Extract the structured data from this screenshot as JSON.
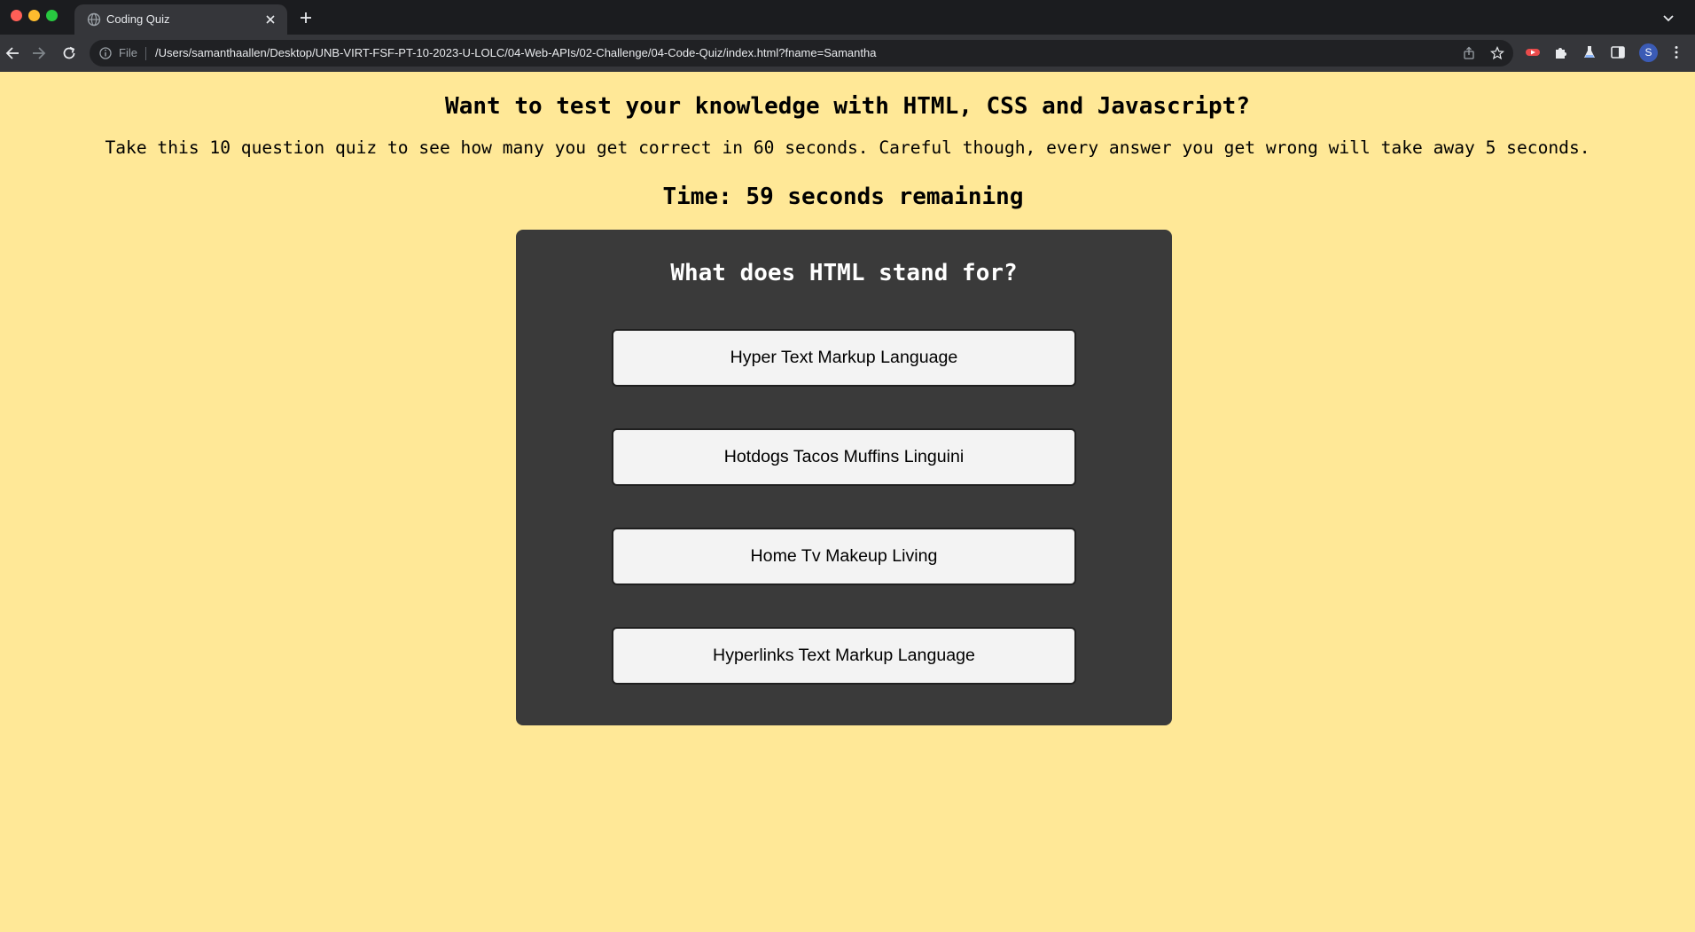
{
  "browser": {
    "tab": {
      "title": "Coding Quiz",
      "favicon": "globe-icon"
    },
    "omnibox": {
      "scheme_label": "File",
      "url": "/Users/samanthaallen/Desktop/UNB-VIRT-FSF-PT-10-2023-U-LOLC/04-Web-APIs/02-Challenge/04-Code-Quiz/index.html?fname=Samantha"
    },
    "profile_initial": "S",
    "colors": {
      "tabstrip": "#1b1c1f",
      "toolbar": "#35363a",
      "omnibox": "#202124",
      "avatar": "#3b5bb5"
    }
  },
  "page": {
    "heading": "Want to test your knowledge with HTML, CSS and Javascript?",
    "intro": "Take this 10 question quiz to see how many you get correct in 60 seconds. Careful though, every answer you get wrong will take away 5 seconds.",
    "timer": "Time: 59 seconds remaining",
    "colors": {
      "background": "#ffe897",
      "card": "#3a3a3a",
      "answer_button": "#f3f3f3"
    }
  },
  "quiz": {
    "question": "What does HTML stand for?",
    "answers": [
      "Hyper Text Markup Language",
      "Hotdogs Tacos Muffins Linguini",
      "Home Tv Makeup Living",
      "Hyperlinks Text Markup Language"
    ]
  }
}
